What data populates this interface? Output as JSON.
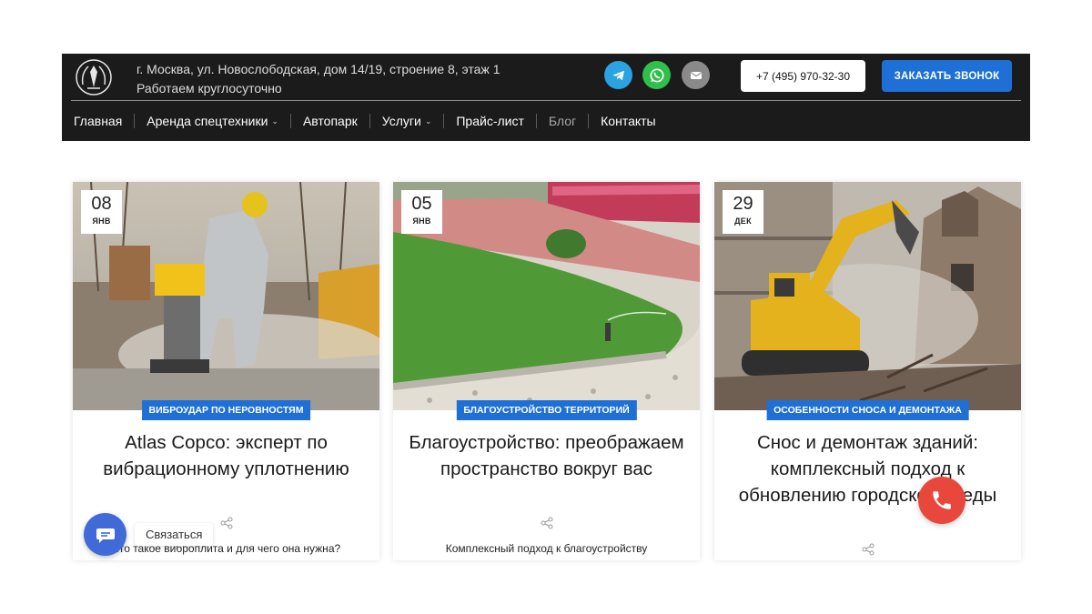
{
  "header": {
    "address": "г. Москва, ул. Новослободская, дом 14/19, строение 8, этаж 1",
    "hours": "Работаем круглосуточно",
    "phone": "+7 (495) 970-32-30",
    "call_button": "ЗАКАЗАТЬ ЗВОНОК",
    "social": [
      "telegram-icon",
      "whatsapp-icon",
      "mail-icon"
    ]
  },
  "nav": {
    "items": [
      {
        "label": "Главная"
      },
      {
        "label": "Аренда спецтехники"
      },
      {
        "label": "Автопарк"
      },
      {
        "label": "Услуги"
      },
      {
        "label": "Прайс-лист"
      },
      {
        "label": "Блог"
      },
      {
        "label": "Контакты"
      }
    ]
  },
  "posts": [
    {
      "day": "08",
      "month": "ЯНВ",
      "tag": "ВИБРОУДАР ПО НЕРОВНОСТЯМ",
      "title": "Atlas Copco: эксперт по вибрационному уплотнению",
      "excerpt": "Что такое виброплита и для чего она нужна?"
    },
    {
      "day": "05",
      "month": "ЯНВ",
      "tag": "БЛАГОУСТРОЙСТВО ТЕРРИТОРИЙ",
      "title": "Благоустройство: преображаем пространство вокруг вас",
      "excerpt": "Комплексный подход к благоустройству"
    },
    {
      "day": "29",
      "month": "ДЕК",
      "tag": "ОСОБЕННОСТИ СНОСА И ДЕМОНТАЖА",
      "title": "Снос и демонтаж зданий: комплексный подход к обновлению городской среды",
      "excerpt": ""
    }
  ],
  "widgets": {
    "chat_label": "Связаться"
  },
  "colors": {
    "accent": "#1e6fd6",
    "header_bg": "#1b1b1b",
    "phone_fab": "#e8473b"
  }
}
